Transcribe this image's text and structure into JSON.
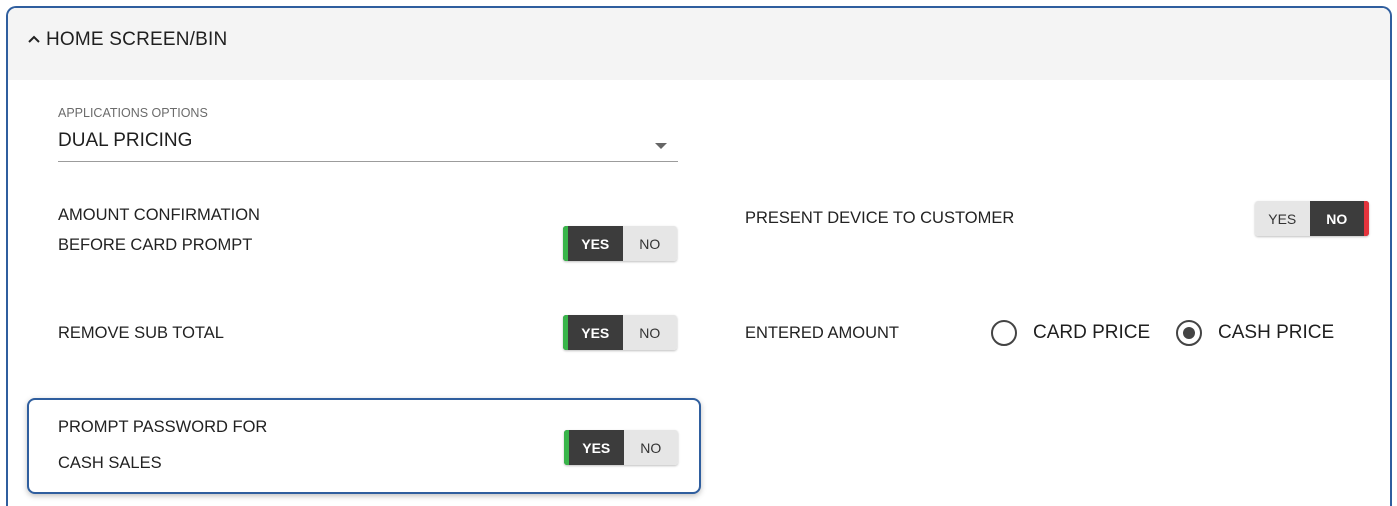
{
  "section": {
    "title": "HOME SCREEN/BIN",
    "collapse_icon": "chevron-up-icon"
  },
  "applications_options": {
    "label": "APPLICATIONS OPTIONS",
    "value": "DUAL PRICING",
    "arrow_icon": "dropdown-arrow-icon"
  },
  "settings": {
    "amount_confirmation": {
      "line1": "AMOUNT CONFIRMATION",
      "line2": "BEFORE CARD PROMPT",
      "yes": "YES",
      "no": "NO",
      "selected": "YES"
    },
    "present_device": {
      "label": "PRESENT DEVICE TO CUSTOMER",
      "yes": "YES",
      "no": "NO",
      "selected": "NO"
    },
    "remove_sub_total": {
      "label": "REMOVE SUB TOTAL",
      "yes": "YES",
      "no": "NO",
      "selected": "YES"
    },
    "entered_amount": {
      "label": "ENTERED AMOUNT",
      "options": [
        "CARD PRICE",
        "CASH PRICE"
      ],
      "selected": "CASH PRICE"
    },
    "prompt_password": {
      "line1": "PROMPT PASSWORD FOR",
      "line2": "CASH SALES",
      "yes": "YES",
      "no": "NO",
      "selected": "YES"
    }
  },
  "colors": {
    "accent_border": "#2f5e9e",
    "yes_indicator": "#39b54a",
    "no_indicator": "#e5343d",
    "toggle_active": "#3c3c3c",
    "toggle_inactive": "#e6e6e6"
  }
}
